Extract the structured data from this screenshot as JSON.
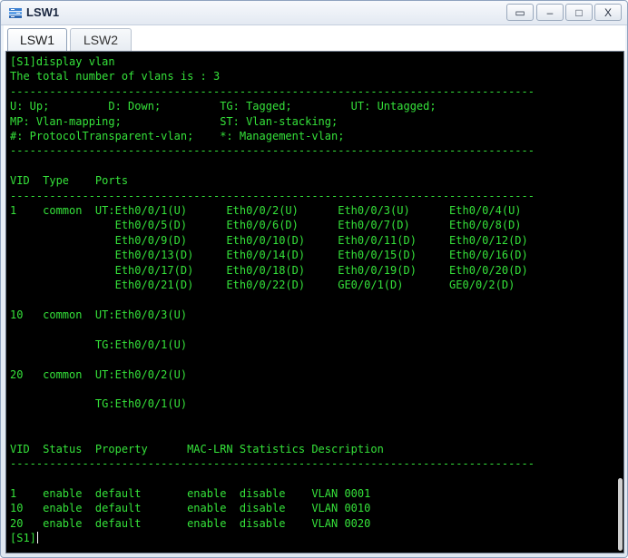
{
  "window": {
    "title": "LSW1",
    "controls": {
      "restore": "▭",
      "minimize": "–",
      "maximize": "□",
      "close": "X"
    }
  },
  "tabs": [
    {
      "label": "LSW1",
      "active": true
    },
    {
      "label": "LSW2",
      "active": false
    }
  ],
  "terminal": {
    "lines": [
      "[S1]display vlan",
      "The total number of vlans is : 3",
      "--------------------------------------------------------------------------------",
      "U: Up;         D: Down;         TG: Tagged;         UT: Untagged;",
      "MP: Vlan-mapping;               ST: Vlan-stacking;",
      "#: ProtocolTransparent-vlan;    *: Management-vlan;",
      "--------------------------------------------------------------------------------",
      "",
      "VID  Type    Ports",
      "--------------------------------------------------------------------------------",
      "1    common  UT:Eth0/0/1(U)      Eth0/0/2(U)      Eth0/0/3(U)      Eth0/0/4(U)",
      "                Eth0/0/5(D)      Eth0/0/6(D)      Eth0/0/7(D)      Eth0/0/8(D)",
      "                Eth0/0/9(D)      Eth0/0/10(D)     Eth0/0/11(D)     Eth0/0/12(D)",
      "                Eth0/0/13(D)     Eth0/0/14(D)     Eth0/0/15(D)     Eth0/0/16(D)",
      "                Eth0/0/17(D)     Eth0/0/18(D)     Eth0/0/19(D)     Eth0/0/20(D)",
      "                Eth0/0/21(D)     Eth0/0/22(D)     GE0/0/1(D)       GE0/0/2(D)",
      "",
      "10   common  UT:Eth0/0/3(U)",
      "",
      "             TG:Eth0/0/1(U)",
      "",
      "20   common  UT:Eth0/0/2(U)",
      "",
      "             TG:Eth0/0/1(U)",
      "",
      "",
      "VID  Status  Property      MAC-LRN Statistics Description",
      "--------------------------------------------------------------------------------",
      "",
      "1    enable  default       enable  disable    VLAN 0001",
      "10   enable  default       enable  disable    VLAN 0010",
      "20   enable  default       enable  disable    VLAN 0020"
    ],
    "prompt": "[S1]",
    "text_color": "#35e23a",
    "background": "#000000"
  }
}
